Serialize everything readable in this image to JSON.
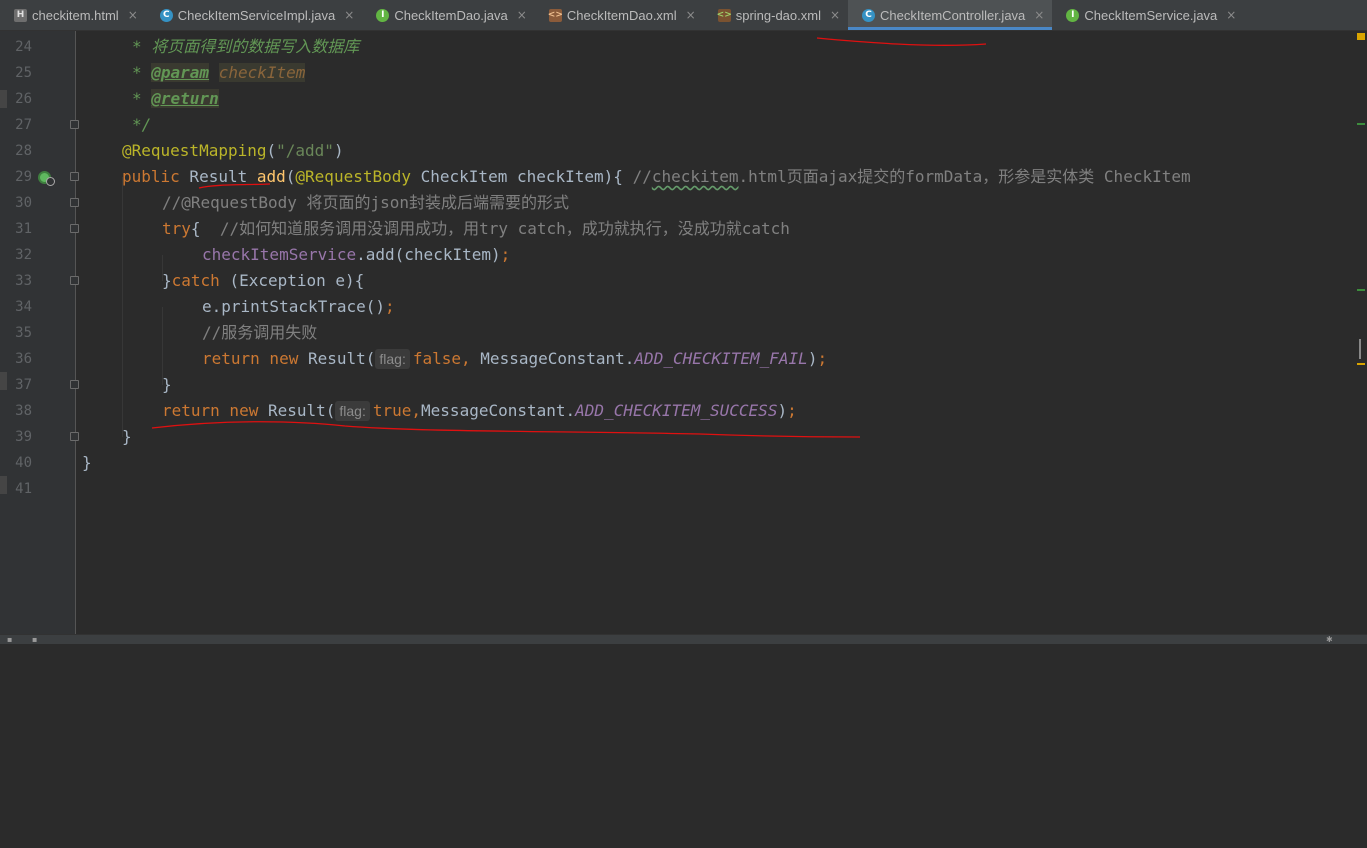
{
  "tabs": [
    {
      "label": "checkitem.html",
      "icon": "html-file-icon",
      "active": false
    },
    {
      "label": "CheckItemServiceImpl.java",
      "icon": "class-icon",
      "active": false
    },
    {
      "label": "CheckItemDao.java",
      "icon": "interface-icon",
      "active": false
    },
    {
      "label": "CheckItemDao.xml",
      "icon": "xml-file-icon",
      "active": false
    },
    {
      "label": "spring-dao.xml",
      "icon": "spring-xml-icon",
      "active": false
    },
    {
      "label": "CheckItemController.java",
      "icon": "class-icon",
      "active": true
    },
    {
      "label": "CheckItemService.java",
      "icon": "interface-icon",
      "active": false
    }
  ],
  "tab_close_glyph": "×",
  "line_numbers": [
    "24",
    "25",
    "26",
    "27",
    "28",
    "29",
    "30",
    "31",
    "32",
    "33",
    "34",
    "35",
    "36",
    "37",
    "38",
    "39",
    "40",
    "41"
  ],
  "code": {
    "l24": {
      "text": "* 将页面得到的数据写入数据库"
    },
    "l25": {
      "star": "* ",
      "tag": "@param",
      "param": "checkItem"
    },
    "l26": {
      "star": "* ",
      "tag": "@return"
    },
    "l27": {
      "text": "*/"
    },
    "l28": {
      "annotation": "@RequestMapping",
      "open": "(",
      "string": "\"/add\"",
      "close": ")"
    },
    "l29": {
      "kw_public": "public",
      "type": " Result ",
      "method": "add",
      "open": "(",
      "annotation": "@RequestBody",
      "params": " CheckItem checkItem){ ",
      "comment_start": "//",
      "comment_typo": "checkitem",
      "comment_rest": ".html页面ajax提交的formData，形参是实体类 CheckItem"
    },
    "l30": {
      "text": "//@RequestBody 将页面的json封装成后端需要的形式"
    },
    "l31": {
      "kw": "try",
      "brace": "{  ",
      "comment": "//如何知道服务调用没调用成功，用try catch，成功就执行，没成功就catch"
    },
    "l32": {
      "field": "checkItemService",
      "rest": ".add(checkItem)",
      "semi": ";"
    },
    "l33": {
      "brace": "}",
      "kw": "catch",
      "rest": " (Exception e){"
    },
    "l34": {
      "text": "e.printStackTrace()",
      "semi": ";"
    },
    "l35": {
      "text": "//服务调用失败"
    },
    "l36": {
      "kw_return": "return",
      "kw_new": " new",
      "ctor": " Result(",
      "hint": "flag:",
      "value": "false",
      "comma": ", ",
      "cls": "MessageConstant.",
      "constant": "ADD_CHECKITEM_FAIL",
      "close": ")",
      "semi": ";"
    },
    "l37": {
      "text": "}"
    },
    "l38": {
      "kw_return": "return",
      "kw_new": " new",
      "ctor": " Result(",
      "hint": "flag:",
      "value": "true",
      "comma": ",",
      "cls": "MessageConstant.",
      "constant": "ADD_CHECKITEM_SUCCESS",
      "close": ")",
      "semi": ";"
    },
    "l39": {
      "text": "}"
    },
    "l40": {
      "text": "}"
    }
  },
  "colors": {
    "background": "#2b2b2b",
    "keyword": "#cc7832",
    "annotation": "#bbb529",
    "string": "#6a8759",
    "comment": "#808080",
    "doc_comment": "#629755",
    "field": "#9876aa",
    "method": "#ffc66d",
    "plain": "#a9b7c6",
    "active_tab_underline": "#4a88c7",
    "annotation_pen": "#e01010"
  }
}
